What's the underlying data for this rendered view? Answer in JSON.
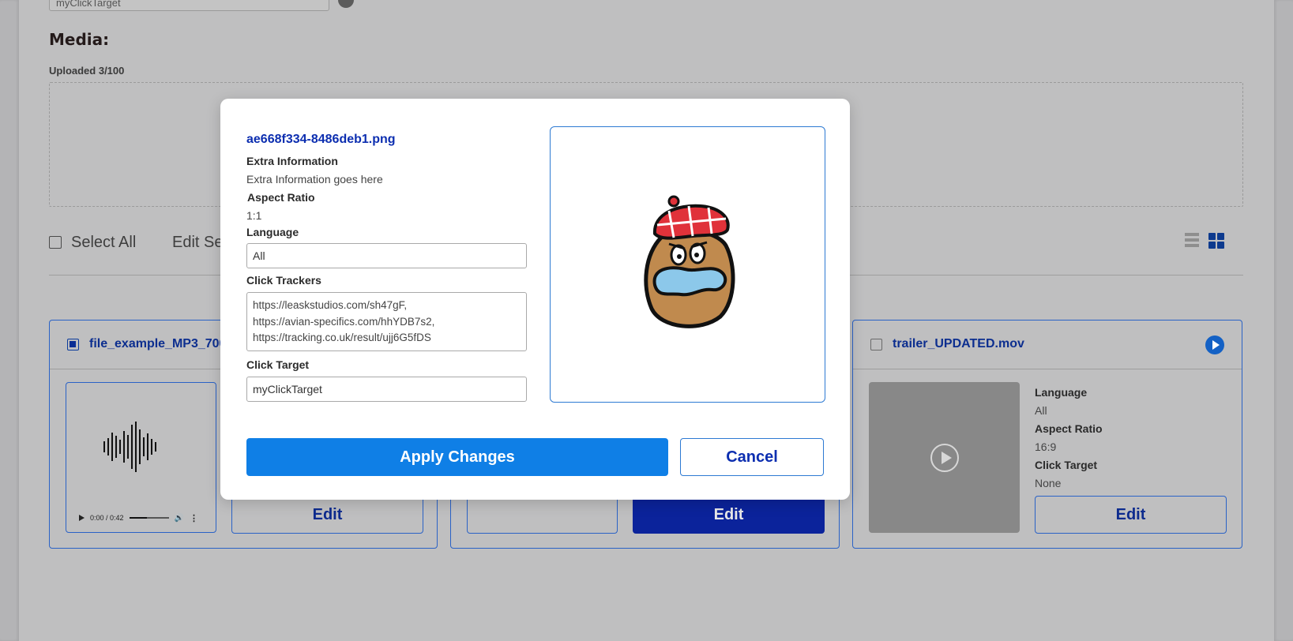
{
  "background": {
    "top_input_value": "myClickTarget",
    "media_heading": "Media:",
    "uploaded_label": "Uploaded 3/100",
    "select_all_label": "Select All",
    "edit_selected_label": "Edit Selected",
    "cards": [
      {
        "title": "file_example_MP3_700KB.mp3",
        "checked": true,
        "audio_time": "0:00 / 0:42",
        "edit_label": "Edit"
      },
      {
        "edit_label": "Edit"
      },
      {
        "title": "trailer_UPDATED.mov",
        "checked": false,
        "meta": [
          {
            "key": "Language",
            "value": "All"
          },
          {
            "key": "Aspect Ratio",
            "value": "16:9"
          },
          {
            "key": "Click Target",
            "value": "None"
          }
        ],
        "edit_label": "Edit"
      }
    ]
  },
  "modal": {
    "filename": "ae668f334-8486deb1.png",
    "extra_info_label": "Extra Information",
    "extra_info_value": "Extra Information goes here",
    "aspect_ratio_label": "Aspect Ratio",
    "aspect_ratio_value": "1:1",
    "language_label": "Language",
    "language_value": "All",
    "click_trackers_label": "Click Trackers",
    "click_trackers": [
      "https://leaskstudios.com/sh47gF,",
      "https://avian-specifics.com/hhYDB7s2,",
      "https://tracking.co.uk/result/ujj6G5fDS"
    ],
    "click_target_label": "Click Target",
    "click_target_value": "myClickTarget",
    "apply_label": "Apply Changes",
    "cancel_label": "Cancel"
  },
  "colors": {
    "primary_blue": "#0f7fe6",
    "dark_blue": "#0b239b",
    "link_blue": "#0c2eb0",
    "overlay_gray": "#bfbfc0"
  }
}
